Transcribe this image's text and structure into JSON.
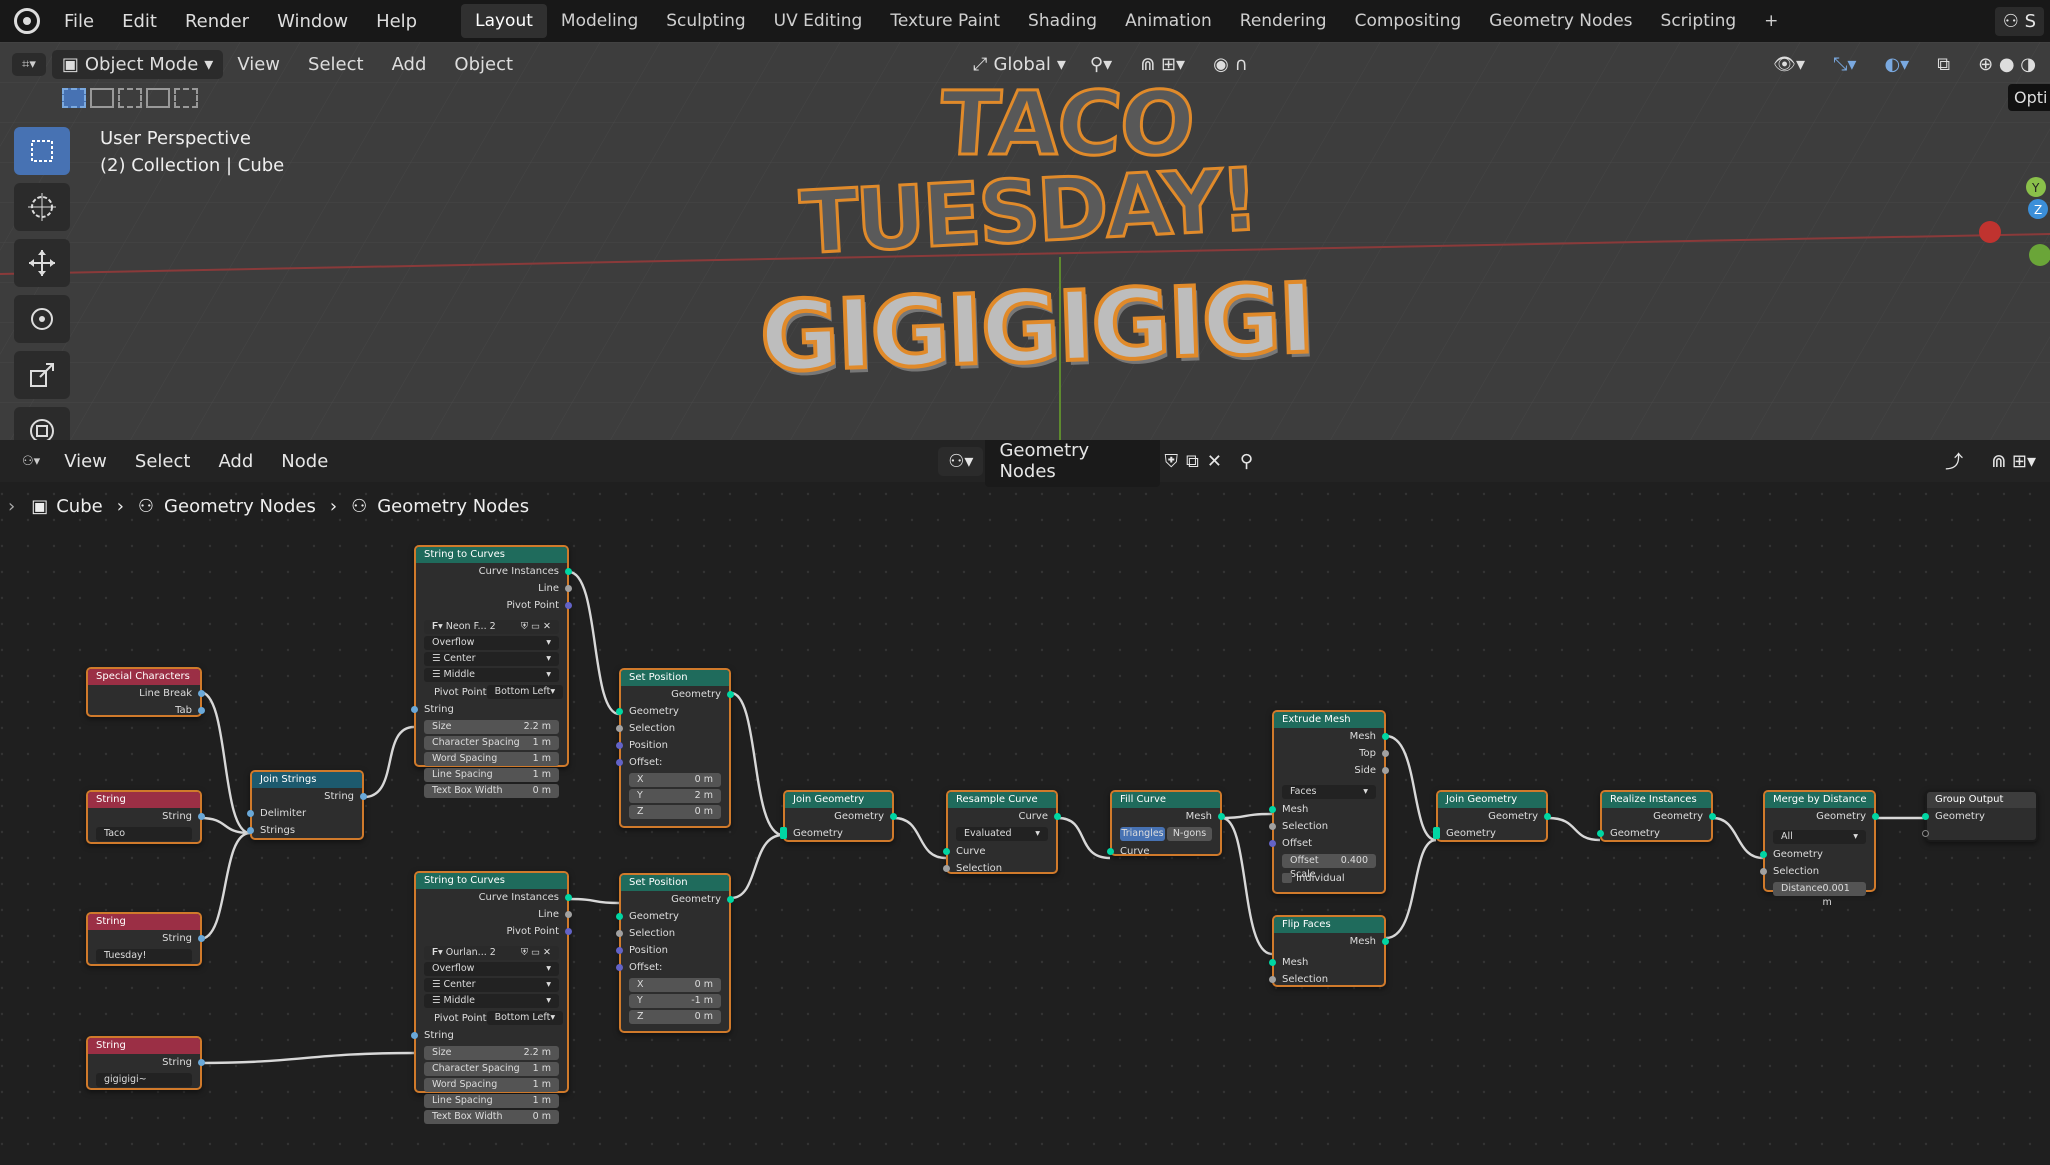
{
  "topbar": {
    "menus": [
      "File",
      "Edit",
      "Render",
      "Window",
      "Help"
    ],
    "workspaces": [
      "Layout",
      "Modeling",
      "Sculpting",
      "UV Editing",
      "Texture Paint",
      "Shading",
      "Animation",
      "Rendering",
      "Compositing",
      "Geometry Nodes",
      "Scripting"
    ],
    "active_workspace": "Layout",
    "right_text": "S"
  },
  "viewport": {
    "mode": "Object Mode",
    "menus": [
      "View",
      "Select",
      "Add",
      "Object"
    ],
    "transform": "Global",
    "perspective": "User Perspective",
    "collection": "(2) Collection | Cube",
    "options": "Opti",
    "text_lines": [
      "TACO",
      "TUESDAY!",
      "GIGIGIGIGI"
    ]
  },
  "editor": {
    "menus": [
      "View",
      "Select",
      "Add",
      "Node"
    ],
    "tree_name": "Geometry Nodes",
    "breadcrumb": [
      "Cube",
      "Geometry Nodes",
      "Geometry Nodes"
    ]
  },
  "nodes": {
    "special": {
      "title": "Special Characters",
      "out1": "Line Break",
      "out2": "Tab"
    },
    "str1": {
      "title": "String",
      "out": "String",
      "value": "Taco"
    },
    "str2": {
      "title": "String",
      "out": "String",
      "value": "Tuesday!"
    },
    "str3": {
      "title": "String",
      "out": "String",
      "value": "gigigigi~"
    },
    "join_strings": {
      "title": "Join Strings",
      "out": "String",
      "in1": "Delimiter",
      "in2": "Strings"
    },
    "stc1": {
      "title": "String to Curves",
      "o1": "Curve Instances",
      "o2": "Line",
      "o3": "Pivot Point",
      "font": "Neon F...",
      "users": "2",
      "overflow": "Overflow",
      "align": "Center",
      "valign": "Middle",
      "pivot_label": "Pivot Point",
      "pivot": "Bottom Left",
      "string": "String",
      "size_l": "Size",
      "size_v": "2.2 m",
      "cs_l": "Character Spacing",
      "cs_v": "1 m",
      "ws_l": "Word Spacing",
      "ws_v": "1 m",
      "ls_l": "Line Spacing",
      "ls_v": "1 m",
      "tbw_l": "Text Box Width",
      "tbw_v": "0 m"
    },
    "stc2": {
      "title": "String to Curves",
      "o1": "Curve Instances",
      "o2": "Line",
      "o3": "Pivot Point",
      "font": "Ourlan...",
      "users": "2",
      "overflow": "Overflow",
      "align": "Center",
      "valign": "Middle",
      "pivot_label": "Pivot Point",
      "pivot": "Bottom Left",
      "string": "String",
      "size_l": "Size",
      "size_v": "2.2 m",
      "cs_l": "Character Spacing",
      "cs_v": "1 m",
      "ws_l": "Word Spacing",
      "ws_v": "1 m",
      "ls_l": "Line Spacing",
      "ls_v": "1 m",
      "tbw_l": "Text Box Width",
      "tbw_v": "0 m"
    },
    "setpos1": {
      "title": "Set Position",
      "out": "Geometry",
      "i1": "Geometry",
      "i2": "Selection",
      "i3": "Position",
      "i4": "Offset:",
      "x": "0 m",
      "y": "2 m",
      "z": "0 m"
    },
    "setpos2": {
      "title": "Set Position",
      "out": "Geometry",
      "i1": "Geometry",
      "i2": "Selection",
      "i3": "Position",
      "i4": "Offset:",
      "x": "0 m",
      "y": "-1 m",
      "z": "0 m"
    },
    "join1": {
      "title": "Join Geometry",
      "out": "Geometry",
      "in": "Geometry"
    },
    "resample": {
      "title": "Resample Curve",
      "out": "Curve",
      "mode": "Evaluated",
      "i1": "Curve",
      "i2": "Selection"
    },
    "fill": {
      "title": "Fill Curve",
      "out": "Mesh",
      "opt1": "Triangles",
      "opt2": "N-gons",
      "in": "Curve"
    },
    "extrude": {
      "title": "Extrude Mesh",
      "o1": "Mesh",
      "o2": "Top",
      "o3": "Side",
      "mode": "Faces",
      "i1": "Mesh",
      "i2": "Selection",
      "i3": "Offset",
      "scale_l": "Offset Scale",
      "scale_v": "0.400",
      "indiv": "Individual"
    },
    "flip": {
      "title": "Flip Faces",
      "out": "Mesh",
      "i1": "Mesh",
      "i2": "Selection"
    },
    "join2": {
      "title": "Join Geometry",
      "out": "Geometry",
      "in": "Geometry"
    },
    "realize": {
      "title": "Realize Instances",
      "out": "Geometry",
      "in": "Geometry"
    },
    "merge": {
      "title": "Merge by Distance",
      "out": "Geometry",
      "mode": "All",
      "i1": "Geometry",
      "i2": "Selection",
      "dist_l": "Distance",
      "dist_v": "0.001 m"
    },
    "output": {
      "title": "Group Output",
      "in": "Geometry"
    }
  }
}
